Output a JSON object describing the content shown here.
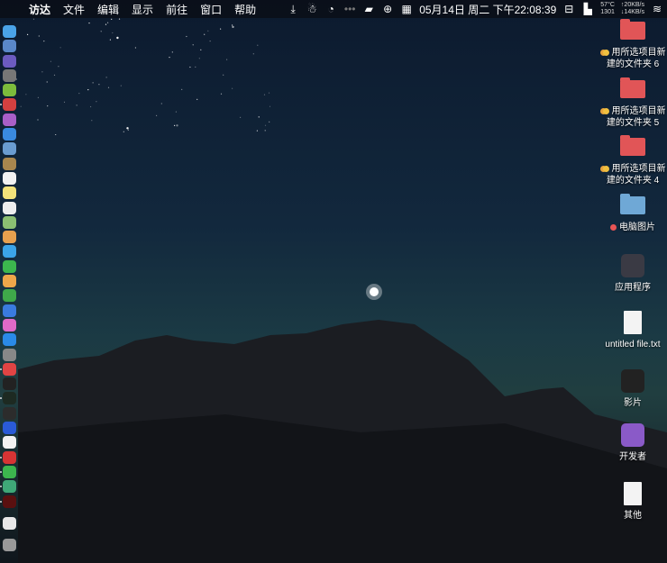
{
  "menubar": {
    "app_name": "访达",
    "items": [
      "文件",
      "编辑",
      "显示",
      "前往",
      "窗口",
      "帮助"
    ],
    "clock": "05月14日 周二 下午22:08:39",
    "temp": "57°C",
    "rpm": "1301",
    "upload": "↑20KB/s",
    "download": "↓14KB/s",
    "status_icons": [
      "download-icon",
      "qq-icon",
      "dashboard-icon",
      "dots-icon",
      "notification-icon",
      "globe-icon",
      "calendar-icon",
      "display-icon",
      "bookmark-icon",
      "wifi-icon"
    ]
  },
  "dock": [
    {
      "name": "finder",
      "color": "#4aa3e8"
    },
    {
      "name": "safari-app",
      "color": "#5a88c9"
    },
    {
      "name": "siri",
      "color": "#6c5bbf"
    },
    {
      "name": "launchpad",
      "color": "#777"
    },
    {
      "name": "android-studio",
      "color": "#7cbc3c"
    },
    {
      "name": "app-red",
      "color": "#d44040",
      "dot": true
    },
    {
      "name": "app-purple",
      "color": "#a95fc8"
    },
    {
      "name": "safari",
      "color": "#3a8ae0"
    },
    {
      "name": "preview",
      "color": "#6a9cd0"
    },
    {
      "name": "notebook",
      "color": "#a8864e"
    },
    {
      "name": "calendar",
      "color": "#f2f2f2"
    },
    {
      "name": "notes",
      "color": "#f3e27a"
    },
    {
      "name": "reminders",
      "color": "#eeeeee"
    },
    {
      "name": "maps",
      "color": "#8bbf72"
    },
    {
      "name": "photos",
      "color": "#e6a04e"
    },
    {
      "name": "messages",
      "color": "#3ba4e8"
    },
    {
      "name": "facetime",
      "color": "#3cb64e"
    },
    {
      "name": "pages",
      "color": "#eea64a"
    },
    {
      "name": "numbers",
      "color": "#3fa84a"
    },
    {
      "name": "keynote",
      "color": "#3a7be0"
    },
    {
      "name": "itunes",
      "color": "#e06ac8"
    },
    {
      "name": "app-store",
      "color": "#2a8ae8"
    },
    {
      "name": "system-preferences",
      "color": "#888"
    },
    {
      "name": "vivaldi",
      "color": "#e04444",
      "dot": true
    },
    {
      "name": "terminal",
      "color": "#222"
    },
    {
      "name": "activity-monitor",
      "color": "#1d2a22",
      "dot": true
    },
    {
      "name": "console",
      "color": "#2c2c2c"
    },
    {
      "name": "vmware",
      "color": "#2a5bd7"
    },
    {
      "name": "yandex",
      "color": "#f2f2f2"
    },
    {
      "name": "netease-music",
      "color": "#d63434",
      "dot": true
    },
    {
      "name": "wechat",
      "color": "#3cb64e",
      "dot": true
    },
    {
      "name": "app-green",
      "color": "#3fa878",
      "dot": true
    },
    {
      "name": "app-darkred",
      "color": "#5a1010",
      "dot": true
    },
    {
      "name": "document",
      "color": "#e8e8e8"
    },
    {
      "name": "trash",
      "color": "#999"
    }
  ],
  "desktop": [
    {
      "label1": "用所选项目新",
      "label2": "建的文件夹 6",
      "type": "folder",
      "color": "#e15557",
      "tags": [
        "#e8a33c",
        "#f0c040"
      ]
    },
    {
      "label1": "用所选项目新",
      "label2": "建的文件夹 5",
      "type": "folder",
      "color": "#e15557",
      "tags": [
        "#e8a33c",
        "#f0c040"
      ]
    },
    {
      "label1": "用所选项目新",
      "label2": "建的文件夹 4",
      "type": "folder",
      "color": "#e15557",
      "tags": [
        "#e8a33c",
        "#f0c040"
      ]
    },
    {
      "label1": "电脑图片",
      "type": "folder",
      "color": "#6fa8d6",
      "tags": [
        "#e85555"
      ]
    },
    {
      "label1": "应用程序",
      "type": "app",
      "color": "#3a3a44"
    },
    {
      "label1": "untitled file.txt",
      "type": "file"
    },
    {
      "label1": "影片",
      "type": "app",
      "color": "#222"
    },
    {
      "label1": "开发者",
      "type": "app",
      "color": "#8a5ac8"
    },
    {
      "label1": "其他",
      "type": "file"
    }
  ]
}
